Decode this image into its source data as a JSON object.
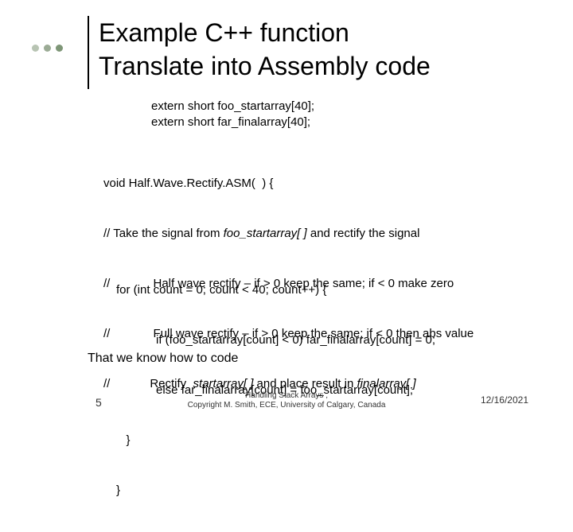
{
  "title_line1": "Example C++ function",
  "title_line2": "Translate into Assembly code",
  "decl_line1": "extern short foo_startarray[40];",
  "decl_line2": "extern short far_finalarray[40];",
  "body1": {
    "l1": "void Half.Wave.Rectify.ASM(  ) {",
    "l2_a": "// Take the signal from ",
    "l2_b": "foo_startarray[ ]",
    "l2_c": " and rectify the signal",
    "l3": "//             Half wave rectify – if > 0 keep the same; if < 0 make zero",
    "l4": "//             Full wave rectify – if > 0 keep the same; if < 0 then abs value",
    "l5_a": "//            Rectify  ",
    "l5_b": "startarray[ ]",
    "l5_c": " and place result in ",
    "l5_d": "finalarray[ ]"
  },
  "body2": {
    "l1": "for (int count = 0; count < 40; count++) {",
    "l2": "            if (foo_startarray[count] < 0) far_finalarray[count] = 0;",
    "l3": "            else far_finalarray[count] = foo_startarray[count];",
    "l4": "   }",
    "l5": "}"
  },
  "know": "That we know how to code",
  "pagenum": "5",
  "footer_line1": "Handling Stack Arrays                     ,",
  "footer_line2": "Copyright M. Smith, ECE, University of Calgary, Canada",
  "date": "12/16/2021"
}
